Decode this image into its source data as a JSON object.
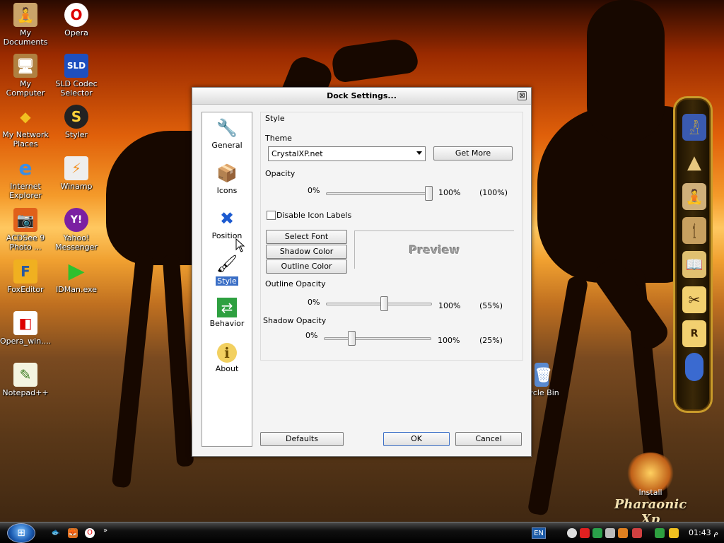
{
  "desktop": {
    "icons": [
      {
        "label": "My\nDocuments",
        "glyph": "🧘"
      },
      {
        "label": "Opera",
        "glyph": "O"
      },
      {
        "label": "My Computer",
        "glyph": "🖥"
      },
      {
        "label": "SLD Codec\nSelector",
        "glyph": "SLD"
      },
      {
        "label": "My Network\nPlaces",
        "glyph": "◆"
      },
      {
        "label": "Styler",
        "glyph": "S"
      },
      {
        "label": "Internet\nExplorer",
        "glyph": "e"
      },
      {
        "label": "Winamp",
        "glyph": "⚡"
      },
      {
        "label": "ACDSee 9\nPhoto ...",
        "glyph": "📷"
      },
      {
        "label": "Yahoo!\nMessenger",
        "glyph": "Y!"
      },
      {
        "label": "FoxEditor",
        "glyph": "F"
      },
      {
        "label": "IDMan.exe",
        "glyph": "▶"
      },
      {
        "label": "Opera_win....",
        "glyph": "◧"
      },
      {
        "label": "Notepad++",
        "glyph": "✎"
      },
      {
        "label": "cycle Bin",
        "glyph": "🗑"
      }
    ]
  },
  "dialog": {
    "title": "Dock Settings...",
    "close_glyph": "⊠",
    "sidebar": [
      {
        "label": "General",
        "glyph": "🔧"
      },
      {
        "label": "Icons",
        "glyph": "📦"
      },
      {
        "label": "Position",
        "glyph": "✖"
      },
      {
        "label": "Style",
        "glyph": "🖌"
      },
      {
        "label": "Behavior",
        "glyph": "⇄"
      },
      {
        "label": "About",
        "glyph": "ℹ"
      }
    ],
    "selected": "Style",
    "style": {
      "group_label": "Style",
      "theme_label": "Theme",
      "theme_value": "CrystalXP.net",
      "get_more": "Get More",
      "opacity_label": "Opacity",
      "opacity_min": "0%",
      "opacity_max": "100%",
      "opacity_value": "(100%)",
      "opacity_level": 1.0,
      "disable_labels": "Disable Icon Labels",
      "disable_labels_checked": false,
      "select_font": "Select Font",
      "shadow_color": "Shadow Color",
      "outline_color": "Outline Color",
      "preview": "Preview",
      "outline_opacity_label": "Outline Opacity",
      "outline_min": "0%",
      "outline_max": "100%",
      "outline_value": "(55%)",
      "outline_level": 0.55,
      "shadow_opacity_label": "Shadow Opacity",
      "shadow_min": "0%",
      "shadow_max": "100%",
      "shadow_value": "(25%)",
      "shadow_level": 0.25
    },
    "buttons": {
      "defaults": "Defaults",
      "ok": "OK",
      "cancel": "Cancel"
    }
  },
  "dock": {
    "items": [
      "pharaoh",
      "pyramids",
      "scribe",
      "harp",
      "book",
      "tools",
      "scroll",
      "capsule"
    ]
  },
  "brand": {
    "line1": "Install",
    "line2": "Pharaonic Xp"
  },
  "taskbar": {
    "start_glyph": "⊞",
    "quicklaunch": [
      "🐟",
      "🦊",
      "O"
    ],
    "more": "»",
    "lang": "EN",
    "clock": "01:43 م"
  },
  "colors": {
    "accent": "#3b6fc6",
    "dock_border": "#c99b2a"
  }
}
